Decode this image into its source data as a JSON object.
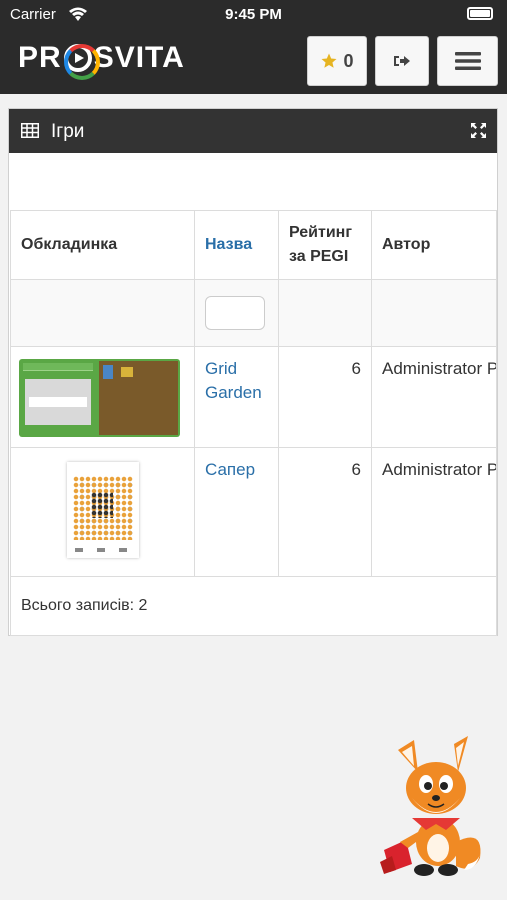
{
  "status_bar": {
    "carrier": "Carrier",
    "time": "9:45 PM"
  },
  "header": {
    "logo_text_left": "PR",
    "logo_text_right": "SVITA",
    "favorites_count": "0",
    "icons": {
      "favorites": "star-icon",
      "logout": "sign-out-icon",
      "menu": "hamburger-icon"
    },
    "colors": {
      "background": "#2b2b2b",
      "star": "#e6b422"
    }
  },
  "panel": {
    "title": "Ігри",
    "icons": {
      "title": "table-grid-icon",
      "expand": "expand-icon"
    },
    "table": {
      "columns": [
        "Обкладинка",
        "Назва",
        "Рейтинг за PEGI",
        "Автор"
      ],
      "rows": [
        {
          "cover": "grid-garden-thumbnail",
          "name": "Grid Garden",
          "pegi": "6",
          "author": "Administrator Prosvita"
        },
        {
          "cover": "saper-thumbnail",
          "name": "Сапер",
          "pegi": "6",
          "author": "Administrator Prosvita"
        }
      ],
      "footer": "Всього записів: 2"
    },
    "colors": {
      "link": "#2a6fa8",
      "header": "#333333"
    }
  },
  "mascot": "fox-mascot"
}
